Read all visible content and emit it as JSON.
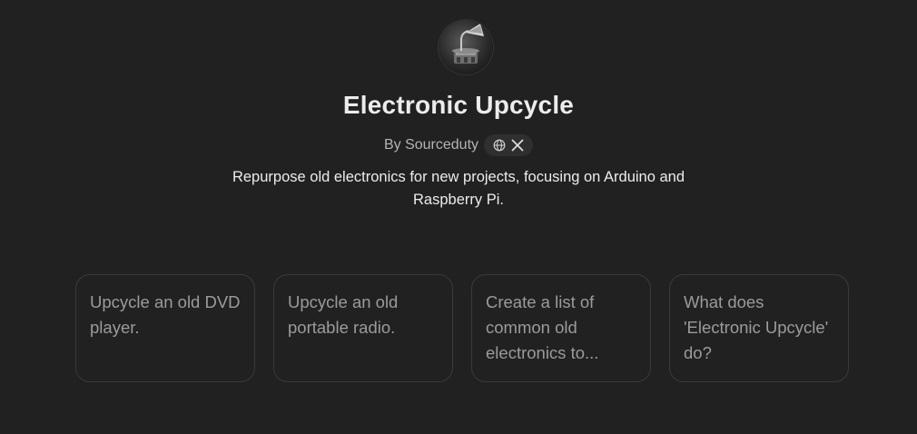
{
  "gpt": {
    "avatar_icon": "gramophone-icon",
    "title": "Electronic Upcycle",
    "author": "By Sourceduty",
    "social_icons": [
      "globe-icon",
      "x-logo-icon"
    ],
    "description": "Repurpose old electronics for new projects, focusing on Arduino and Raspberry Pi."
  },
  "starters": [
    {
      "text": "Upcycle an old DVD player."
    },
    {
      "text": "Upcycle an old portable radio."
    },
    {
      "text": "Create a list of common old electronics to..."
    },
    {
      "text": "What does 'Electronic Upcycle' do?"
    }
  ],
  "colors": {
    "background": "#212121",
    "text_primary": "#ececec",
    "text_secondary": "#b4b4b4",
    "card_border": "#3a3a3a",
    "card_text": "#9b9b9b"
  }
}
